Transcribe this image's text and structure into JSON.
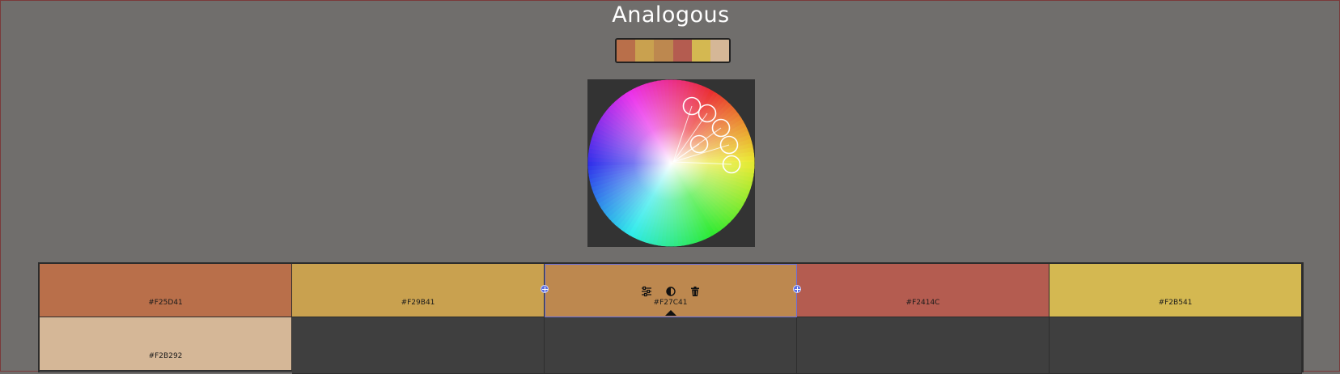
{
  "title": "Analogous",
  "preview_colors": [
    "#b96f4a",
    "#c9a14f",
    "#bd884f",
    "#b45c50",
    "#d4b851",
    "#d5b797"
  ],
  "swatches": [
    {
      "label": "#F25D41",
      "color": "#b96f4a"
    },
    {
      "label": "#F29B41",
      "color": "#c9a14f"
    },
    {
      "label": "#F27C41",
      "color": "#bd884f",
      "selected": true
    },
    {
      "label": "#F2414C",
      "color": "#b45c50"
    },
    {
      "label": "#F2B541",
      "color": "#d4b851"
    },
    {
      "label": "#F2B292",
      "color": "#d5b797"
    }
  ],
  "tools": [
    "adjust-sliders-icon",
    "contrast-icon",
    "trash-icon"
  ],
  "wheel_markers": 6
}
